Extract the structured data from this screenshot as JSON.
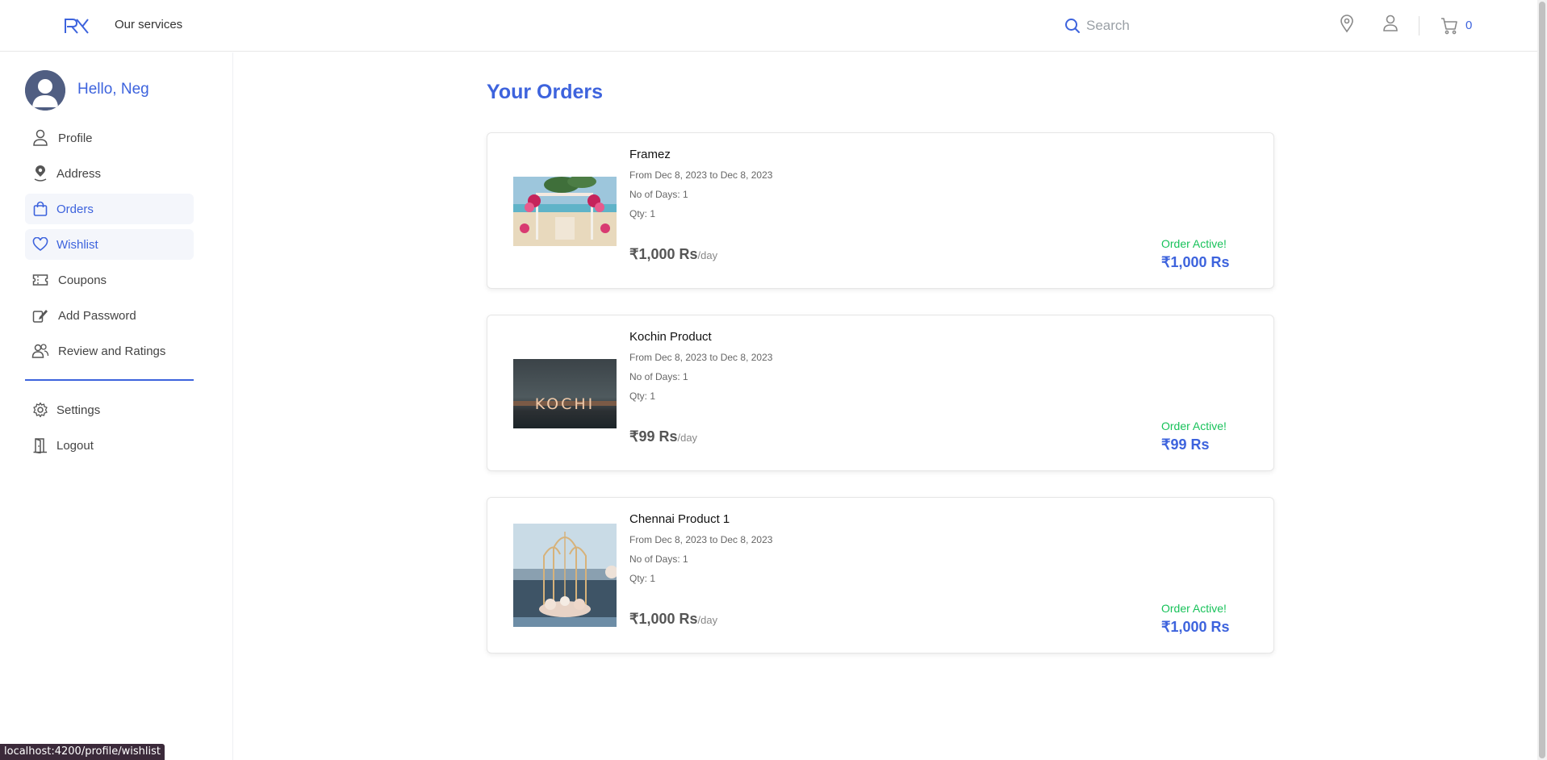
{
  "header": {
    "services_label": "Our services",
    "search_placeholder": "Search",
    "cart_count": "0",
    "brand_color": "#3d63dd"
  },
  "sidebar": {
    "greeting": "Hello, Neg",
    "items": [
      {
        "label": "Profile",
        "icon": "person-icon",
        "active": false
      },
      {
        "label": "Address",
        "icon": "map-pin-icon",
        "active": false
      },
      {
        "label": "Orders",
        "icon": "shopping-bag-icon",
        "active": true
      },
      {
        "label": "Wishlist",
        "icon": "heart-icon",
        "active": true
      },
      {
        "label": "Coupons",
        "icon": "ticket-icon",
        "active": false
      },
      {
        "label": "Add Password",
        "icon": "pen-key-icon",
        "active": false
      },
      {
        "label": "Review and Ratings",
        "icon": "users-icon",
        "active": false
      }
    ],
    "bottom_items": [
      {
        "label": "Settings",
        "icon": "gear-icon"
      },
      {
        "label": "Logout",
        "icon": "door-icon"
      }
    ]
  },
  "main": {
    "title": "Your Orders",
    "orders": [
      {
        "name": "Framez",
        "dates": "From Dec 8, 2023 to Dec 8, 2023",
        "days": "No of Days: 1",
        "qty": "Qty: 1",
        "price": "₹1,000 Rs",
        "per": "/day",
        "status": "Order Active!",
        "total": "₹1,000 Rs",
        "image": "beach-wedding-arch-image"
      },
      {
        "name": "Kochin Product",
        "dates": "From Dec 8, 2023 to Dec 8, 2023",
        "days": "No of Days: 1",
        "qty": "Qty: 1",
        "price": "₹99 Rs",
        "per": "/day",
        "status": "Order Active!",
        "total": "₹99 Rs",
        "image": "kochi-sign-image",
        "image_text": "KOCHI"
      },
      {
        "name": "Chennai Product 1",
        "dates": "From Dec 8, 2023 to Dec 8, 2023",
        "days": "No of Days: 1",
        "qty": "Qty: 1",
        "price": "₹1,000 Rs",
        "per": "/day",
        "status": "Order Active!",
        "total": "₹1,000 Rs",
        "image": "floral-arch-sea-image"
      }
    ]
  },
  "statusbar": {
    "url": "localhost:4200/profile/wishlist"
  }
}
